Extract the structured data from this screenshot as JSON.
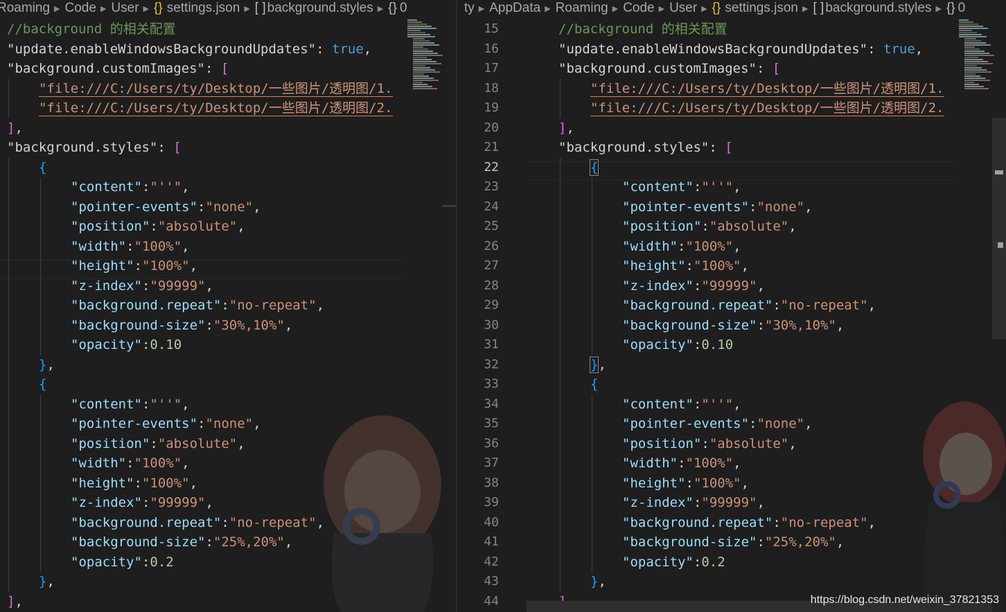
{
  "left_pane": {
    "breadcrumbs": [
      {
        "label": "Roaming",
        "icon": null
      },
      {
        "label": "Code",
        "icon": null
      },
      {
        "label": "User",
        "icon": null
      },
      {
        "label": "settings.json",
        "icon": "braces-icon",
        "icon_text": "{}"
      },
      {
        "label": "background.styles",
        "icon": "array-icon",
        "icon_text": "[ ]"
      },
      {
        "label": "0",
        "icon": "object-icon",
        "icon_text": "{}"
      }
    ]
  },
  "right_pane": {
    "breadcrumbs": [
      {
        "label": "ty",
        "icon": null
      },
      {
        "label": "AppData",
        "icon": null
      },
      {
        "label": "Roaming",
        "icon": null
      },
      {
        "label": "Code",
        "icon": null
      },
      {
        "label": "User",
        "icon": null
      },
      {
        "label": "settings.json",
        "icon": "braces-icon",
        "icon_text": "{}"
      },
      {
        "label": "background.styles",
        "icon": "array-icon",
        "icon_text": "[ ]"
      },
      {
        "label": "0",
        "icon": "object-icon",
        "icon_text": "{}"
      }
    ],
    "line_numbers": [
      "15",
      "16",
      "17",
      "18",
      "19",
      "20",
      "21",
      "22",
      "23",
      "24",
      "25",
      "26",
      "27",
      "28",
      "29",
      "30",
      "31",
      "32",
      "33",
      "34",
      "35",
      "36",
      "37",
      "38",
      "39",
      "40",
      "41",
      "42",
      "43",
      "44"
    ],
    "active_line": "22"
  },
  "code_lines": [
    {
      "indent": 0,
      "tokens": [
        [
          "c-comment",
          "//background 的相关配置"
        ]
      ]
    },
    {
      "indent": 0,
      "tokens": [
        [
          "c-key2",
          "\"update.enableWindowsBackgroundUpdates\""
        ],
        [
          "c-punc",
          ": "
        ],
        [
          "c-bool",
          "true"
        ],
        [
          "c-punc",
          ","
        ]
      ]
    },
    {
      "indent": 0,
      "tokens": [
        [
          "c-key2",
          "\"background.customImages\""
        ],
        [
          "c-punc",
          ": "
        ],
        [
          "c-brk",
          "["
        ]
      ]
    },
    {
      "indent": 1,
      "tokens": [
        [
          "c-str u",
          "\"file:///C:/Users/ty/Desktop/一些图片/透明图/1."
        ]
      ]
    },
    {
      "indent": 1,
      "tokens": [
        [
          "c-str u",
          "\"file:///C:/Users/ty/Desktop/一些图片/透明图/2."
        ]
      ]
    },
    {
      "indent": 0,
      "tokens": [
        [
          "c-brk",
          "]"
        ],
        [
          "c-punc",
          ","
        ]
      ]
    },
    {
      "indent": 0,
      "tokens": [
        [
          "c-key2",
          "\"background.styles\""
        ],
        [
          "c-punc",
          ": "
        ],
        [
          "c-brk",
          "["
        ]
      ]
    },
    {
      "indent": 1,
      "tokens": [
        [
          "c-brc",
          "{"
        ]
      ]
    },
    {
      "indent": 2,
      "tokens": [
        [
          "c-key",
          "\"content\""
        ],
        [
          "c-punc",
          ":"
        ],
        [
          "c-str",
          "\"''\""
        ],
        [
          "c-punc",
          ","
        ]
      ]
    },
    {
      "indent": 2,
      "tokens": [
        [
          "c-key",
          "\"pointer-events\""
        ],
        [
          "c-punc",
          ":"
        ],
        [
          "c-str",
          "\"none\""
        ],
        [
          "c-punc",
          ","
        ]
      ]
    },
    {
      "indent": 2,
      "tokens": [
        [
          "c-key",
          "\"position\""
        ],
        [
          "c-punc",
          ":"
        ],
        [
          "c-str",
          "\"absolute\""
        ],
        [
          "c-punc",
          ","
        ]
      ]
    },
    {
      "indent": 2,
      "tokens": [
        [
          "c-key",
          "\"width\""
        ],
        [
          "c-punc",
          ":"
        ],
        [
          "c-str",
          "\"100%\""
        ],
        [
          "c-punc",
          ","
        ]
      ]
    },
    {
      "indent": 2,
      "tokens": [
        [
          "c-key",
          "\"height\""
        ],
        [
          "c-punc",
          ":"
        ],
        [
          "c-str",
          "\"100%\""
        ],
        [
          "c-punc",
          ","
        ]
      ]
    },
    {
      "indent": 2,
      "tokens": [
        [
          "c-key",
          "\"z-index\""
        ],
        [
          "c-punc",
          ":"
        ],
        [
          "c-str",
          "\"99999\""
        ],
        [
          "c-punc",
          ","
        ]
      ]
    },
    {
      "indent": 2,
      "tokens": [
        [
          "c-key",
          "\"background.repeat\""
        ],
        [
          "c-punc",
          ":"
        ],
        [
          "c-str",
          "\"no-repeat\""
        ],
        [
          "c-punc",
          ","
        ]
      ]
    },
    {
      "indent": 2,
      "tokens": [
        [
          "c-key",
          "\"background-size\""
        ],
        [
          "c-punc",
          ":"
        ],
        [
          "c-str",
          "\"30%,10%\""
        ],
        [
          "c-punc",
          ","
        ]
      ]
    },
    {
      "indent": 2,
      "tokens": [
        [
          "c-key",
          "\"opacity\""
        ],
        [
          "c-punc",
          ":"
        ],
        [
          "c-num",
          "0.10"
        ]
      ]
    },
    {
      "indent": 1,
      "tokens": [
        [
          "c-brc",
          "}"
        ],
        [
          "c-punc",
          ","
        ]
      ]
    },
    {
      "indent": 1,
      "tokens": [
        [
          "c-brc",
          "{"
        ]
      ]
    },
    {
      "indent": 2,
      "tokens": [
        [
          "c-key",
          "\"content\""
        ],
        [
          "c-punc",
          ":"
        ],
        [
          "c-str",
          "\"''\""
        ],
        [
          "c-punc",
          ","
        ]
      ]
    },
    {
      "indent": 2,
      "tokens": [
        [
          "c-key",
          "\"pointer-events\""
        ],
        [
          "c-punc",
          ":"
        ],
        [
          "c-str",
          "\"none\""
        ],
        [
          "c-punc",
          ","
        ]
      ]
    },
    {
      "indent": 2,
      "tokens": [
        [
          "c-key",
          "\"position\""
        ],
        [
          "c-punc",
          ":"
        ],
        [
          "c-str",
          "\"absolute\""
        ],
        [
          "c-punc",
          ","
        ]
      ]
    },
    {
      "indent": 2,
      "tokens": [
        [
          "c-key",
          "\"width\""
        ],
        [
          "c-punc",
          ":"
        ],
        [
          "c-str",
          "\"100%\""
        ],
        [
          "c-punc",
          ","
        ]
      ]
    },
    {
      "indent": 2,
      "tokens": [
        [
          "c-key",
          "\"height\""
        ],
        [
          "c-punc",
          ":"
        ],
        [
          "c-str",
          "\"100%\""
        ],
        [
          "c-punc",
          ","
        ]
      ]
    },
    {
      "indent": 2,
      "tokens": [
        [
          "c-key",
          "\"z-index\""
        ],
        [
          "c-punc",
          ":"
        ],
        [
          "c-str",
          "\"99999\""
        ],
        [
          "c-punc",
          ","
        ]
      ]
    },
    {
      "indent": 2,
      "tokens": [
        [
          "c-key",
          "\"background.repeat\""
        ],
        [
          "c-punc",
          ":"
        ],
        [
          "c-str",
          "\"no-repeat\""
        ],
        [
          "c-punc",
          ","
        ]
      ]
    },
    {
      "indent": 2,
      "tokens": [
        [
          "c-key",
          "\"background-size\""
        ],
        [
          "c-punc",
          ":"
        ],
        [
          "c-str",
          "\"25%,20%\""
        ],
        [
          "c-punc",
          ","
        ]
      ]
    },
    {
      "indent": 2,
      "tokens": [
        [
          "c-key",
          "\"opacity\""
        ],
        [
          "c-punc",
          ":"
        ],
        [
          "c-num",
          "0.2"
        ]
      ]
    },
    {
      "indent": 1,
      "tokens": [
        [
          "c-brc",
          "}"
        ],
        [
          "c-punc",
          ","
        ]
      ]
    },
    {
      "indent": 0,
      "tokens": [
        [
          "c-brk",
          "]"
        ],
        [
          "c-punc",
          ","
        ]
      ]
    }
  ],
  "colors": {
    "editor_bg": "#1e1e1e",
    "string": "#ce9178",
    "key": "#9cdcfe",
    "comment": "#6a9955",
    "bracket": "#da70d6",
    "brace": "#179fff"
  },
  "watermark": "https://blog.csdn.net/weixin_37821353"
}
